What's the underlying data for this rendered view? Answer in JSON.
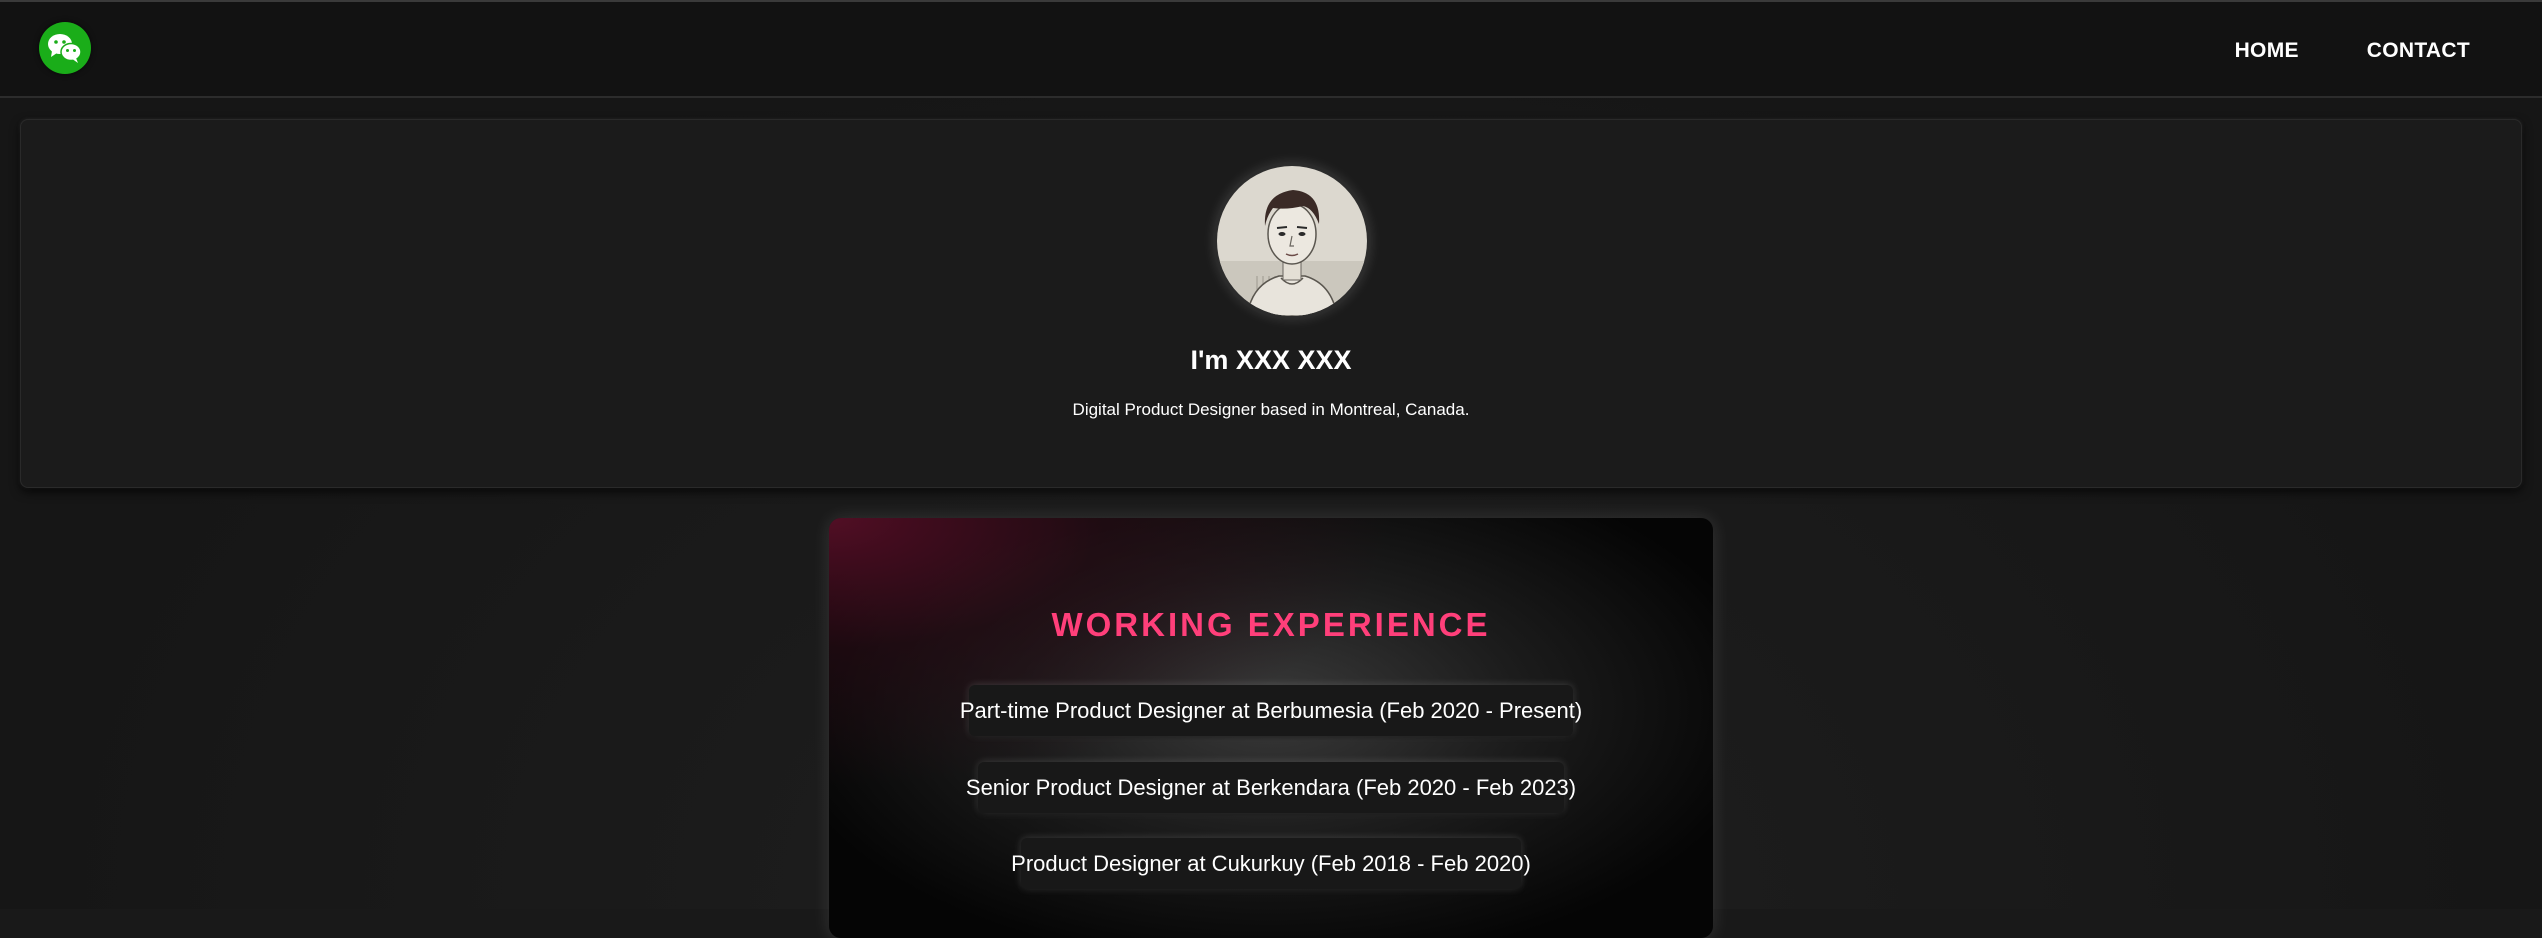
{
  "navbar": {
    "logo_icon": "wechat-icon",
    "logo_color": "#1aad19",
    "links": [
      {
        "label": "HOME"
      },
      {
        "label": "CONTACT"
      }
    ]
  },
  "profile": {
    "avatar_icon": "portrait-avatar",
    "name": "I'm XXX XXX",
    "tagline": "Digital Product Designer based in Montreal, Canada."
  },
  "experience": {
    "title": "WORKING EXPERIENCE",
    "title_color": "#ff3f7a",
    "items": [
      {
        "label": "Part-time Product Designer at Berbumesia (Feb 2020 - Present)"
      },
      {
        "label": "Senior Product Designer at Berkendara (Feb 2020 - Feb 2023)"
      },
      {
        "label": "Product Designer at Cukurkuy (Feb 2018 - Feb 2020)"
      }
    ]
  }
}
